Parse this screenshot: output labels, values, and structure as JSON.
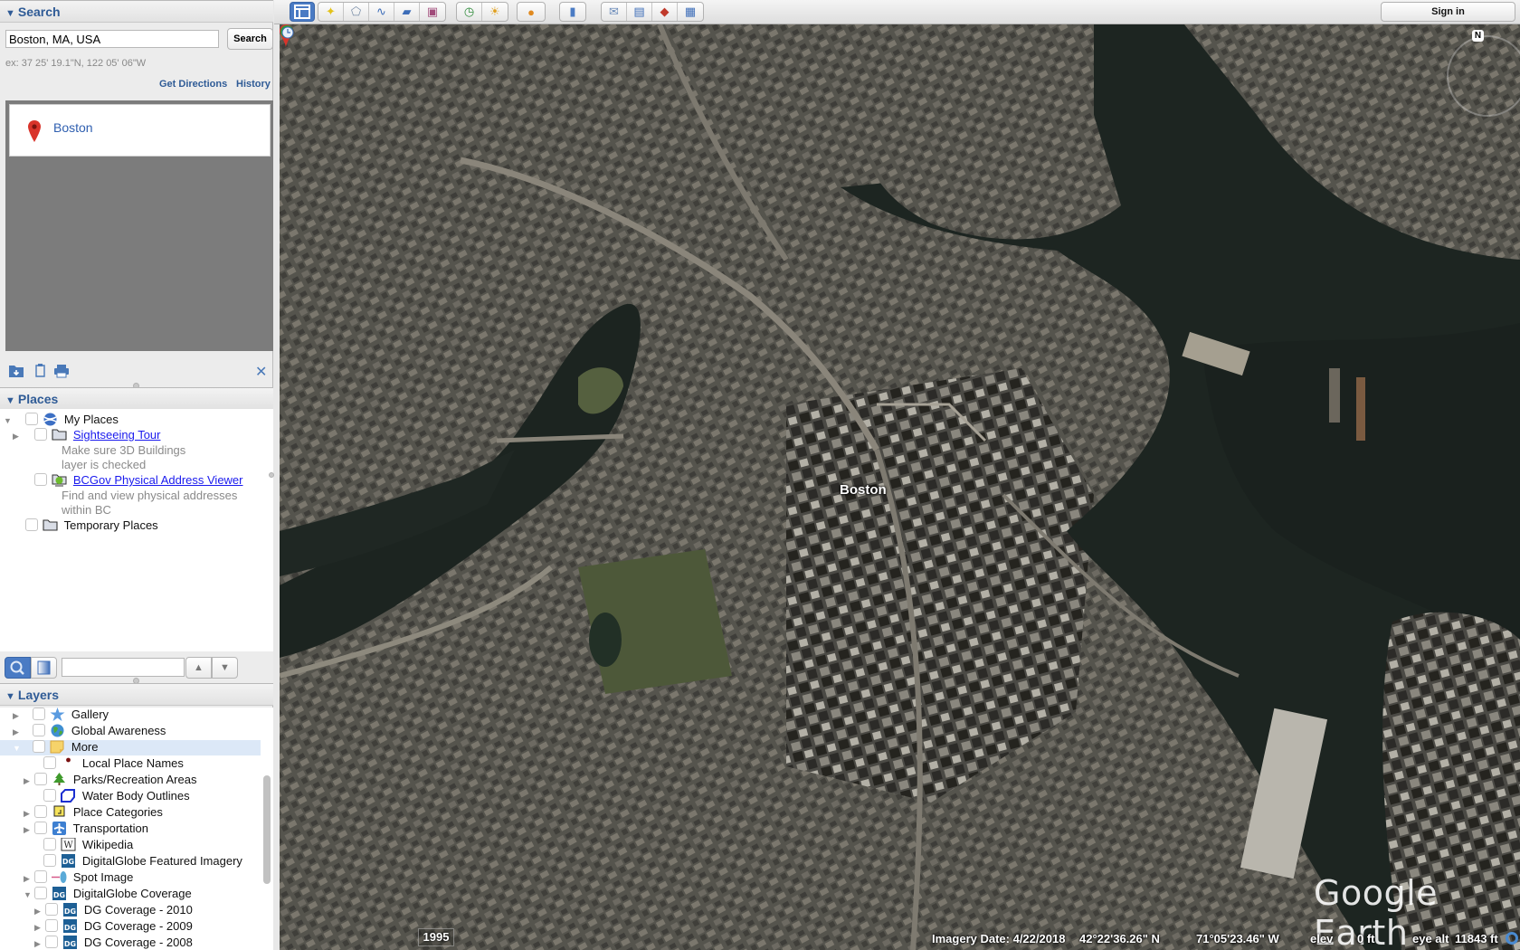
{
  "search_panel": {
    "header": "Search",
    "query_value": "Boston, MA, USA",
    "search_button": "Search",
    "hint": "ex: 37 25' 19.1\"N, 122 05' 06\"W",
    "get_directions": "Get Directions",
    "history": "History",
    "results": [
      {
        "label": "Boston",
        "icon": "red-placemark-pin"
      }
    ],
    "tools": [
      "add-to-my-places-icon",
      "copy-icon",
      "print-icon"
    ],
    "close_label": "✕"
  },
  "places_panel": {
    "header": "Places",
    "items": [
      {
        "label": "My Places",
        "icon": "google-earth-globe",
        "expanded": true,
        "checked": false,
        "link": false
      },
      {
        "label": "Sightseeing Tour",
        "icon": "folder",
        "expanded": false,
        "checked": false,
        "link": true,
        "description": [
          "Make sure 3D Buildings",
          "layer is checked"
        ]
      },
      {
        "label": "BCGov Physical Address Viewer",
        "icon": "network-link",
        "checked": false,
        "link": true,
        "description": [
          "Find and view physical addresses",
          "within BC"
        ]
      },
      {
        "label": "Temporary Places",
        "icon": "folder",
        "checked": false,
        "link": false
      }
    ],
    "search_value": "",
    "nav_up": "▲",
    "nav_down": "▼"
  },
  "layers_panel": {
    "header": "Layers",
    "items": [
      {
        "label": "Gallery",
        "icon": "star",
        "level": 0,
        "expandable": true,
        "expanded": false,
        "checked": false
      },
      {
        "label": "Global Awareness",
        "icon": "globe",
        "level": 0,
        "expandable": true,
        "expanded": false,
        "checked": false
      },
      {
        "label": "More",
        "icon": "note",
        "level": 0,
        "expandable": true,
        "expanded": true,
        "checked": false,
        "selected": true
      },
      {
        "label": "Local Place Names",
        "icon": "dot",
        "level": 1,
        "expandable": false,
        "checked": false
      },
      {
        "label": "Parks/Recreation Areas",
        "icon": "tree",
        "level": 1,
        "expandable": true,
        "expanded": false,
        "checked": false
      },
      {
        "label": "Water Body Outlines",
        "icon": "polygon",
        "level": 1,
        "expandable": false,
        "checked": false
      },
      {
        "label": "Place Categories",
        "icon": "square",
        "level": 1,
        "expandable": true,
        "expanded": false,
        "checked": false
      },
      {
        "label": "Transportation",
        "icon": "airplane",
        "level": 1,
        "expandable": true,
        "expanded": false,
        "checked": false
      },
      {
        "label": "Wikipedia",
        "icon": "wikipedia-w",
        "level": 1,
        "expandable": false,
        "checked": false
      },
      {
        "label": "DigitalGlobe Featured Imagery",
        "icon": "dg",
        "level": 1,
        "expandable": false,
        "checked": false
      },
      {
        "label": "Spot Image",
        "icon": "satellite",
        "level": 1,
        "expandable": true,
        "expanded": false,
        "checked": false
      },
      {
        "label": "DigitalGlobe Coverage",
        "icon": "dg",
        "level": 1,
        "expandable": true,
        "expanded": true,
        "checked": false
      },
      {
        "label": "DG Coverage - 2010",
        "icon": "dg",
        "level": 2,
        "expandable": true,
        "expanded": false,
        "checked": false
      },
      {
        "label": "DG Coverage - 2009",
        "icon": "dg",
        "level": 2,
        "expandable": true,
        "expanded": false,
        "checked": false
      },
      {
        "label": "DG Coverage - 2008",
        "icon": "dg",
        "level": 2,
        "expandable": true,
        "expanded": false,
        "checked": false
      }
    ]
  },
  "toolbar": {
    "groups": [
      [
        {
          "name": "add-placemark-button",
          "glyph": "📌"
        },
        {
          "name": "add-polygon-button",
          "glyph": "⬠"
        },
        {
          "name": "add-path-button",
          "glyph": "∿"
        },
        {
          "name": "add-image-overlay-button",
          "glyph": "▱"
        },
        {
          "name": "record-tour-button",
          "glyph": "🎥"
        }
      ],
      [
        {
          "name": "historical-imagery-button",
          "glyph": "🕓"
        },
        {
          "name": "sunlight-button",
          "glyph": "☀"
        }
      ],
      [
        {
          "name": "planets-button",
          "glyph": "🪐"
        }
      ],
      [
        {
          "name": "ruler-button",
          "glyph": "📏"
        }
      ],
      [
        {
          "name": "email-button",
          "glyph": "✉"
        },
        {
          "name": "print-button",
          "glyph": "🖶"
        },
        {
          "name": "view-in-google-maps-button",
          "glyph": "📍"
        },
        {
          "name": "save-image-button",
          "glyph": "🖼"
        }
      ]
    ],
    "sign_in": "Sign in"
  },
  "map": {
    "place_label": "Boston",
    "compass_label": "N",
    "watermark": "Google Earth",
    "historical_year": "1995",
    "status": {
      "imagery_date": "Imagery Date: 4/22/2018",
      "latitude": "42°22'36.26\" N",
      "longitude": "71°05'23.46\" W",
      "elev_label": "elev",
      "elev_value": "0 ft",
      "eye_alt_label": "eye alt",
      "eye_alt_value": "11843 ft"
    },
    "colors": {
      "water": "#1e2622",
      "land": "#5b5a52",
      "park": "#4f5a3c",
      "road": "#8a857a",
      "pin": "#d9342b",
      "accent": "#4a7bc4"
    }
  }
}
